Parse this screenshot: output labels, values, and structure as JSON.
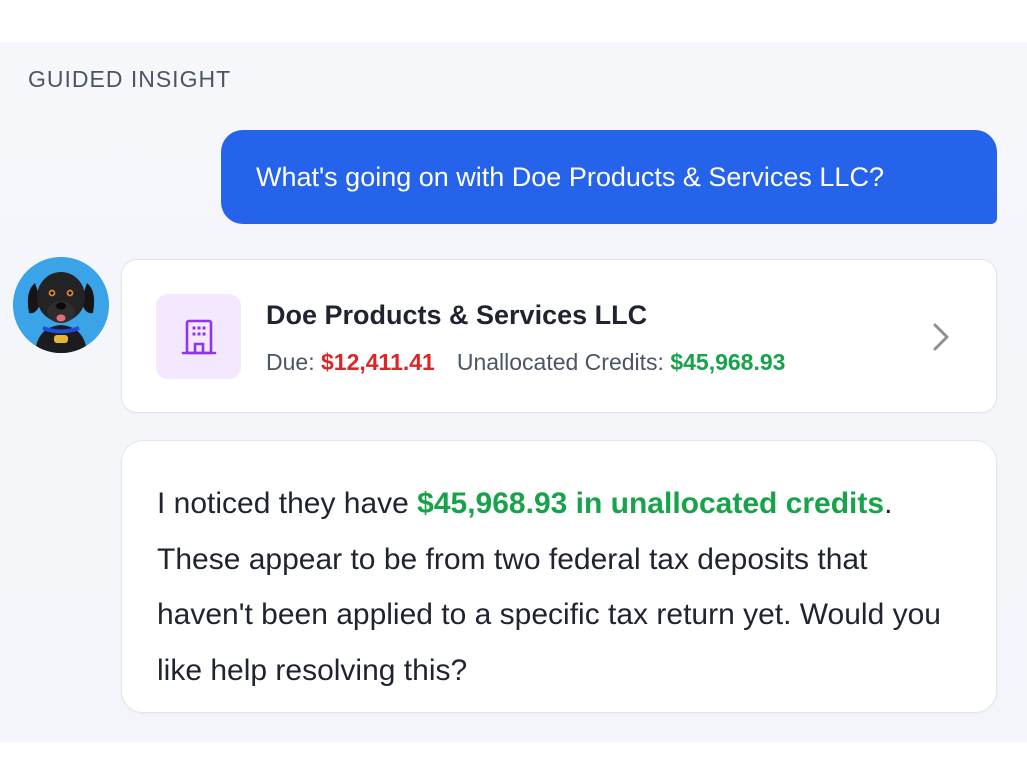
{
  "section": {
    "label": "GUIDED INSIGHT"
  },
  "user_message": {
    "text": "What's going on with Doe Products & Services LLC?"
  },
  "assistant": {
    "avatar_icon": "dog-avatar"
  },
  "entity_card": {
    "icon": "building-icon",
    "name": "Doe Products & Services LLC",
    "due_label": "Due:",
    "due_amount": "$12,411.41",
    "credits_label": "Unallocated Credits:",
    "credits_amount": "$45,968.93",
    "chevron_icon": "chevron-right-icon"
  },
  "assistant_message": {
    "prefix": "I noticed they have ",
    "highlight": "$45,968.93 in unallocated credits",
    "suffix": ". These appear to be from two federal tax deposits that haven't been applied to a specific tax return yet. Would you like help resolving this?"
  },
  "colors": {
    "user_bubble": "#2563eb",
    "due_amount": "#dc2626",
    "credits_amount": "#16a34a",
    "icon_tile": "#f3e8fd",
    "icon_stroke": "#9333ea"
  }
}
